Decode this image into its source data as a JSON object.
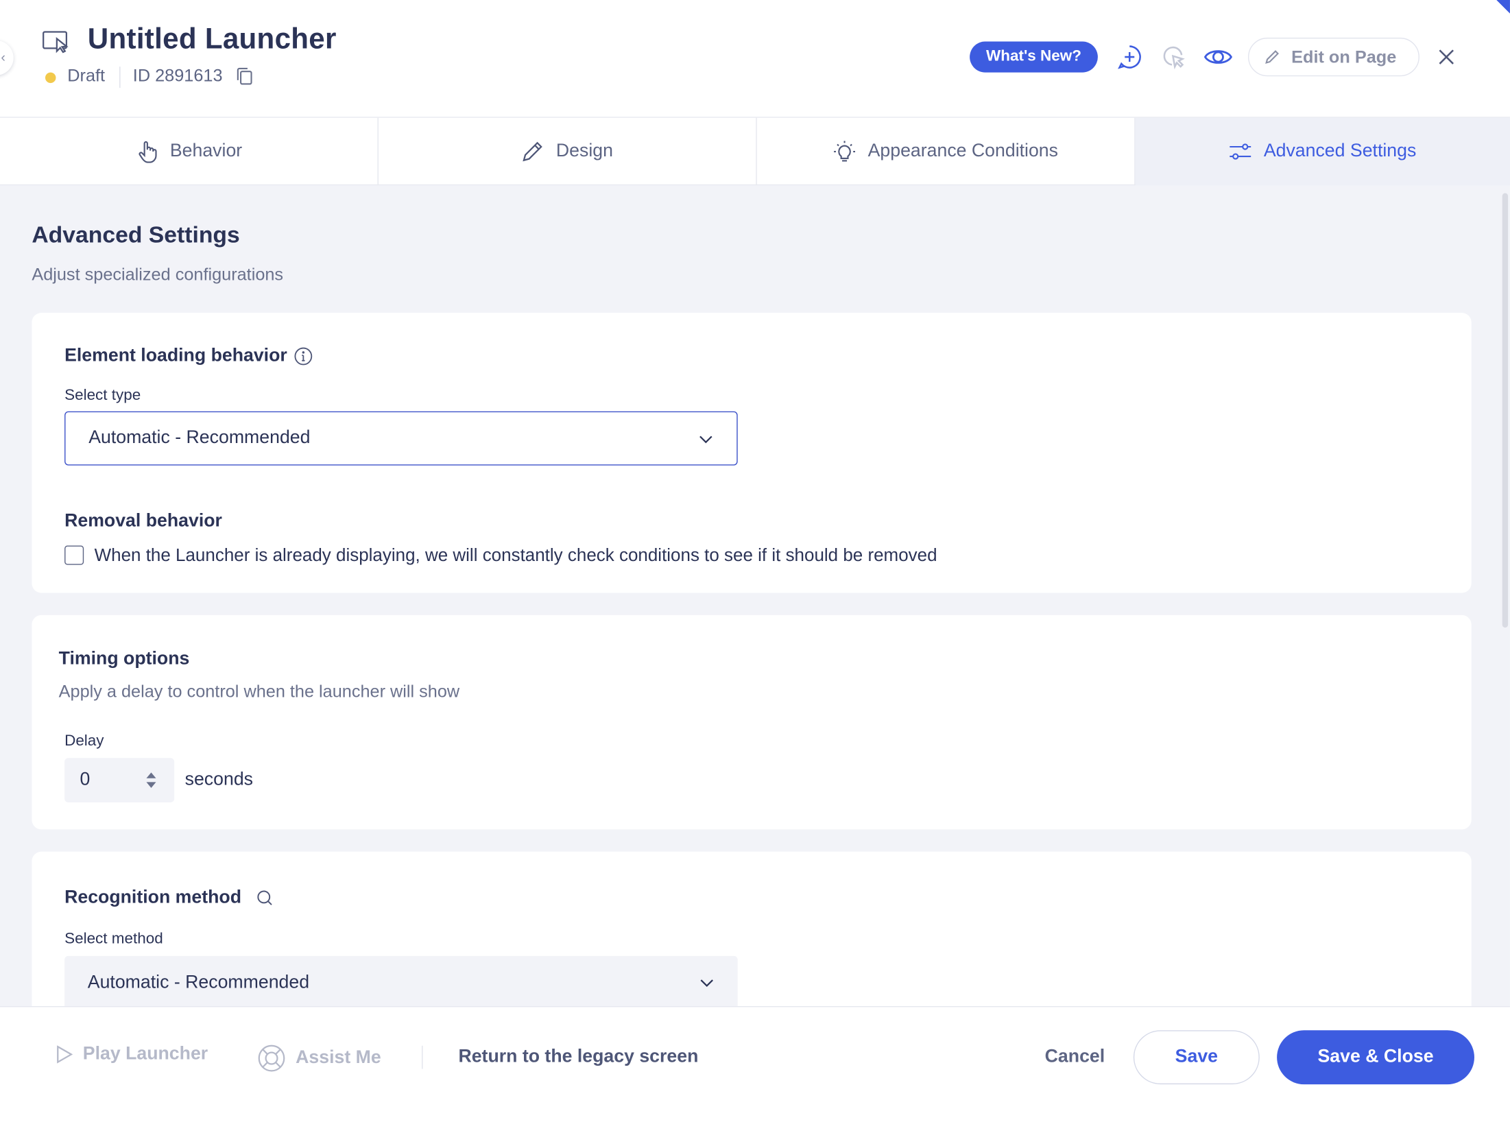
{
  "header": {
    "title": "Untitled Launcher",
    "status": "Draft",
    "id_text": "ID 2891613",
    "whats_new": "What's New?",
    "edit_on_page": "Edit on Page",
    "icons": [
      "launcher-icon",
      "copy-icon",
      "add-comment-icon",
      "cursor-click-icon",
      "eye-icon",
      "pencil-icon",
      "close-icon"
    ]
  },
  "tabs": [
    {
      "label": "Behavior",
      "icon": "hand-pointer-icon"
    },
    {
      "label": "Design",
      "icon": "pencil-icon"
    },
    {
      "label": "Appearance Conditions",
      "icon": "lightbulb-icon"
    },
    {
      "label": "Advanced Settings",
      "icon": "sliders-icon",
      "active": true
    }
  ],
  "page": {
    "title": "Advanced Settings",
    "subtitle": "Adjust specialized configurations"
  },
  "element_loading": {
    "title": "Element loading behavior",
    "select_label": "Select type",
    "select_value": "Automatic - Recommended",
    "removal_title": "Removal behavior",
    "removal_checkbox_label": "When the Launcher is already displaying, we will constantly check conditions to see if it should be removed",
    "removal_checked": false
  },
  "timing": {
    "title": "Timing options",
    "description": "Apply a delay to control when the launcher will show",
    "delay_label": "Delay",
    "delay_value": "0",
    "delay_unit": "seconds"
  },
  "recognition": {
    "title": "Recognition method",
    "select_label": "Select method",
    "select_value": "Automatic - Recommended"
  },
  "footer": {
    "play_launcher": "Play Launcher",
    "assist_me": "Assist Me",
    "legacy_link": "Return to the legacy screen",
    "cancel": "Cancel",
    "save": "Save",
    "save_close": "Save & Close"
  },
  "colors": {
    "accent": "#3d5ce0",
    "draft_status": "#f2c94c",
    "text_primary": "#2b3356",
    "content_bg": "#f2f3f8"
  }
}
